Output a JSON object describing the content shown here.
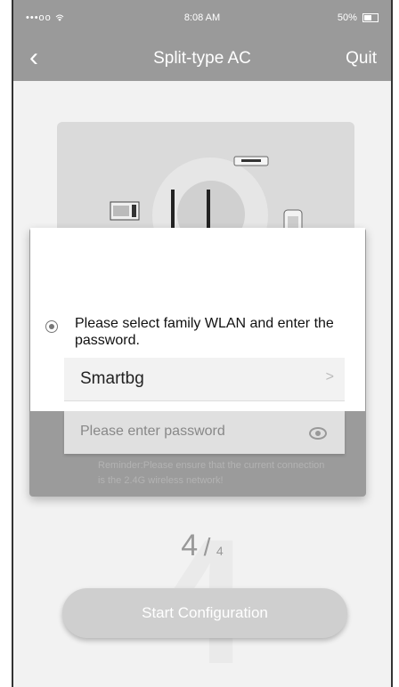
{
  "status_bar": {
    "signal": "•••oo",
    "time": "8:08 AM",
    "battery": "50%"
  },
  "nav": {
    "back": "‹",
    "title": "Split-type AC",
    "quit": "Quit"
  },
  "dialog": {
    "instruction": "Please select family WLAN and enter the password.",
    "wlan_name": "Smartbg",
    "wlan_chevron": ">",
    "password_placeholder": "Please enter password",
    "reminder": "Reminder:Please ensure that the current connection is the 2.4G wireless network!"
  },
  "step": {
    "current": "4",
    "separator": "/",
    "total": "4"
  },
  "start_button": "Start Configuration",
  "icons": [
    "back-icon",
    "wifi-icon",
    "battery-icon",
    "router-icon",
    "air-conditioner-icon",
    "dehumidifier-icon",
    "eye-icon",
    "chevron-right-icon"
  ]
}
